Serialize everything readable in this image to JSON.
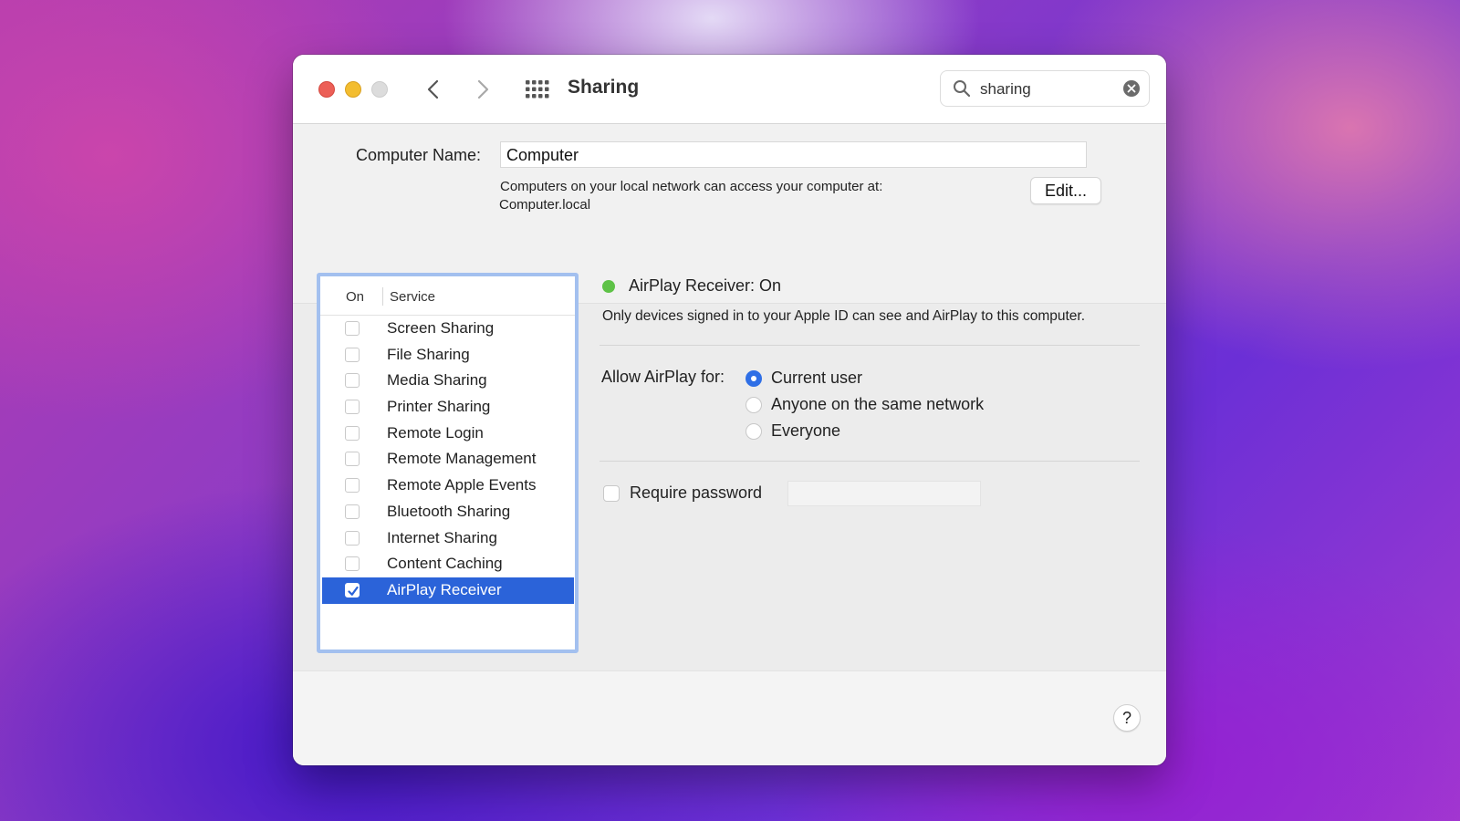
{
  "window": {
    "title": "Sharing"
  },
  "search": {
    "value": "sharing"
  },
  "computer_name": {
    "label": "Computer Name:",
    "value": "Computer",
    "info_line1": "Computers on your local network can access your computer at:",
    "info_line2": "Computer.local",
    "edit_label": "Edit..."
  },
  "services": {
    "header_on": "On",
    "header_service": "Service",
    "items": [
      {
        "label": "Screen Sharing",
        "checked": false
      },
      {
        "label": "File Sharing",
        "checked": false
      },
      {
        "label": "Media Sharing",
        "checked": false
      },
      {
        "label": "Printer Sharing",
        "checked": false
      },
      {
        "label": "Remote Login",
        "checked": false
      },
      {
        "label": "Remote Management",
        "checked": false
      },
      {
        "label": "Remote Apple Events",
        "checked": false
      },
      {
        "label": "Bluetooth Sharing",
        "checked": false
      },
      {
        "label": "Internet Sharing",
        "checked": false
      },
      {
        "label": "Content Caching",
        "checked": false
      },
      {
        "label": "AirPlay Receiver",
        "checked": true,
        "selected": true
      }
    ]
  },
  "detail": {
    "status": "AirPlay Receiver: On",
    "status_color": "#5ec247",
    "description": "Only devices signed in to your Apple ID can see and AirPlay to this computer.",
    "allow_label": "Allow AirPlay for:",
    "options": [
      {
        "label": "Current user",
        "selected": true
      },
      {
        "label": "Anyone on the same network",
        "selected": false
      },
      {
        "label": "Everyone",
        "selected": false
      }
    ],
    "require_password_label": "Require password",
    "require_password_checked": false,
    "password_value": ""
  },
  "help_label": "?",
  "colors": {
    "accent": "#2b63d9",
    "radio_accent": "#2f6fe6"
  }
}
